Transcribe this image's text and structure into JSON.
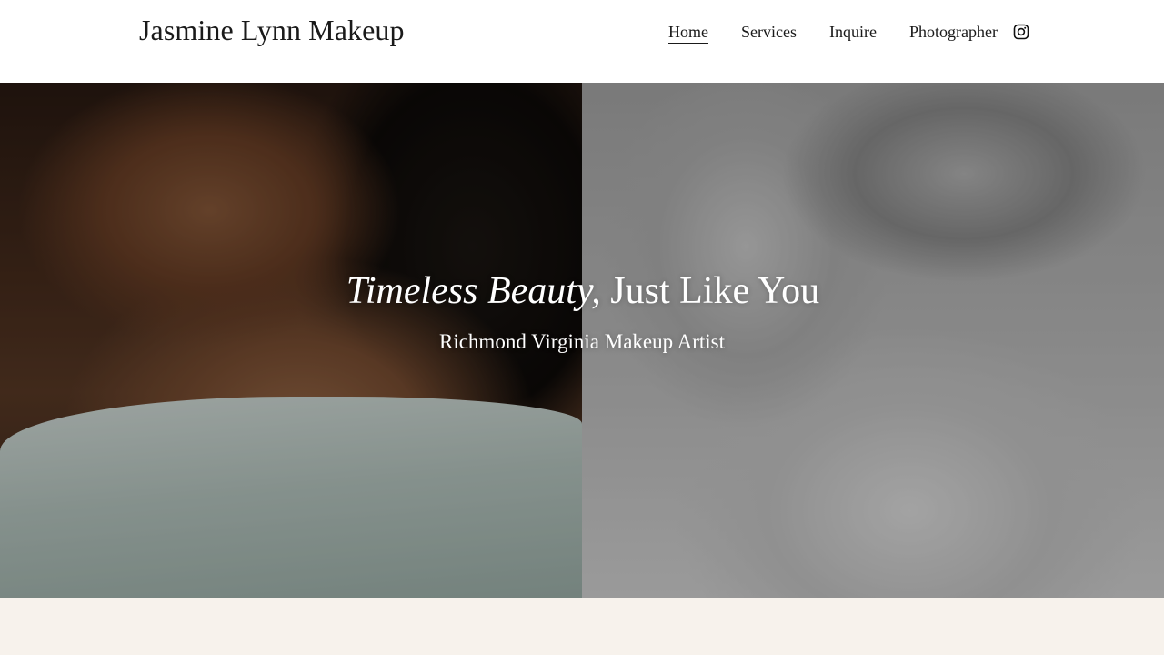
{
  "header": {
    "site_title": "Jasmine Lynn Makeup",
    "nav": [
      {
        "label": "Home",
        "active": true
      },
      {
        "label": "Services",
        "active": false
      },
      {
        "label": "Inquire",
        "active": false
      },
      {
        "label": "Photographer",
        "active": false
      }
    ],
    "social_icon": "instagram-icon"
  },
  "hero": {
    "heading_italic": "Timeless Beauty,",
    "heading_regular": "Just Like You",
    "subheading": "Richmond Virginia Makeup Artist",
    "left_image": "portrait-woman-closed-eyes",
    "right_image": "portrait-woman-profile-bw"
  },
  "colors": {
    "header_bg": "#ffffff",
    "text": "#1a1a1a",
    "hero_text": "#ffffff",
    "section_bg": "#f7f2ec"
  }
}
